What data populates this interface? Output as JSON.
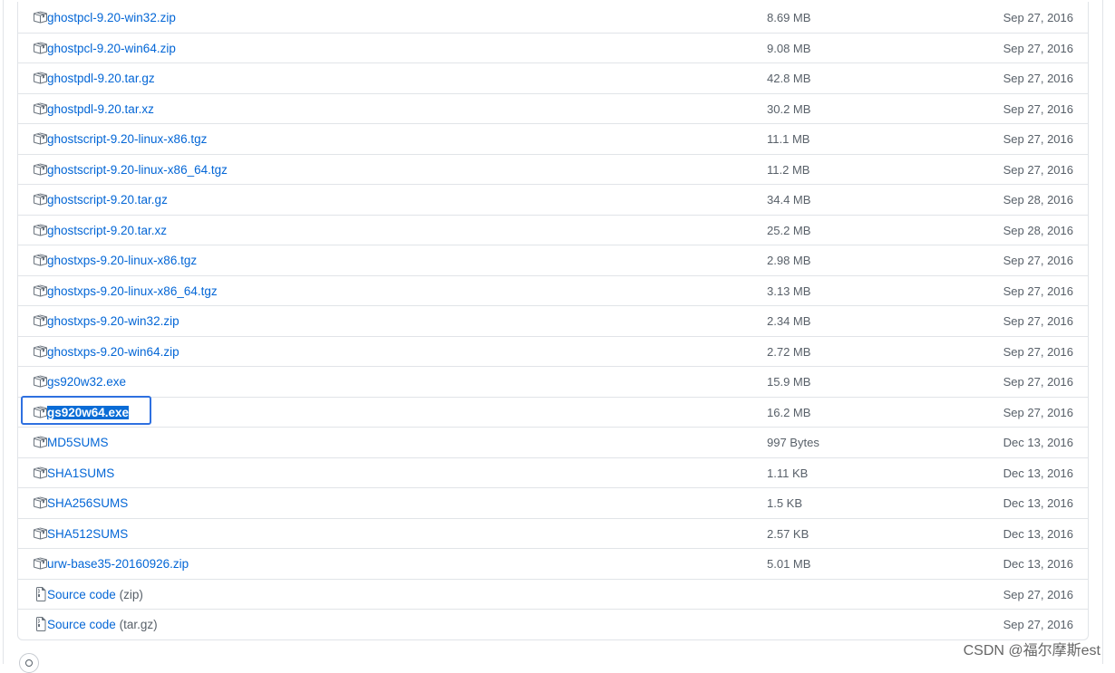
{
  "assets": [
    {
      "name": "ghostpcl-9.20-win32.zip",
      "size": "8.69 MB",
      "date": "Sep 27, 2016",
      "icon": "package-icon"
    },
    {
      "name": "ghostpcl-9.20-win64.zip",
      "size": "9.08 MB",
      "date": "Sep 27, 2016",
      "icon": "package-icon"
    },
    {
      "name": "ghostpdl-9.20.tar.gz",
      "size": "42.8 MB",
      "date": "Sep 27, 2016",
      "icon": "package-icon"
    },
    {
      "name": "ghostpdl-9.20.tar.xz",
      "size": "30.2 MB",
      "date": "Sep 27, 2016",
      "icon": "package-icon"
    },
    {
      "name": "ghostscript-9.20-linux-x86.tgz",
      "size": "11.1 MB",
      "date": "Sep 27, 2016",
      "icon": "package-icon"
    },
    {
      "name": "ghostscript-9.20-linux-x86_64.tgz",
      "size": "11.2 MB",
      "date": "Sep 27, 2016",
      "icon": "package-icon"
    },
    {
      "name": "ghostscript-9.20.tar.gz",
      "size": "34.4 MB",
      "date": "Sep 28, 2016",
      "icon": "package-icon"
    },
    {
      "name": "ghostscript-9.20.tar.xz",
      "size": "25.2 MB",
      "date": "Sep 28, 2016",
      "icon": "package-icon"
    },
    {
      "name": "ghostxps-9.20-linux-x86.tgz",
      "size": "2.98 MB",
      "date": "Sep 27, 2016",
      "icon": "package-icon"
    },
    {
      "name": "ghostxps-9.20-linux-x86_64.tgz",
      "size": "3.13 MB",
      "date": "Sep 27, 2016",
      "icon": "package-icon"
    },
    {
      "name": "ghostxps-9.20-win32.zip",
      "size": "2.34 MB",
      "date": "Sep 27, 2016",
      "icon": "package-icon"
    },
    {
      "name": "ghostxps-9.20-win64.zip",
      "size": "2.72 MB",
      "date": "Sep 27, 2016",
      "icon": "package-icon"
    },
    {
      "name": "gs920w32.exe",
      "size": "15.9 MB",
      "date": "Sep 27, 2016",
      "icon": "package-icon"
    },
    {
      "name": "gs920w64.exe",
      "size": "16.2 MB",
      "date": "Sep 27, 2016",
      "icon": "package-icon",
      "selected": true
    },
    {
      "name": "MD5SUMS",
      "size": "997 Bytes",
      "date": "Dec 13, 2016",
      "icon": "package-icon"
    },
    {
      "name": "SHA1SUMS",
      "size": "1.11 KB",
      "date": "Dec 13, 2016",
      "icon": "package-icon"
    },
    {
      "name": "SHA256SUMS",
      "size": "1.5 KB",
      "date": "Dec 13, 2016",
      "icon": "package-icon"
    },
    {
      "name": "SHA512SUMS",
      "size": "2.57 KB",
      "date": "Dec 13, 2016",
      "icon": "package-icon"
    },
    {
      "name": "urw-base35-20160926.zip",
      "size": "5.01 MB",
      "date": "Dec 13, 2016",
      "icon": "package-icon"
    },
    {
      "name": "Source code",
      "suffix": "(zip)",
      "size": "",
      "date": "Sep 27, 2016",
      "icon": "file-zip-icon"
    },
    {
      "name": "Source code",
      "suffix": "(tar.gz)",
      "size": "",
      "date": "Sep 27, 2016",
      "icon": "file-zip-icon"
    }
  ],
  "watermark": "CSDN @福尔摩斯est",
  "colors": {
    "link": "#0366d6",
    "muted": "#586069",
    "border": "#e1e4e8",
    "selection": "#0a6cd6",
    "focus": "#2e70e0"
  }
}
